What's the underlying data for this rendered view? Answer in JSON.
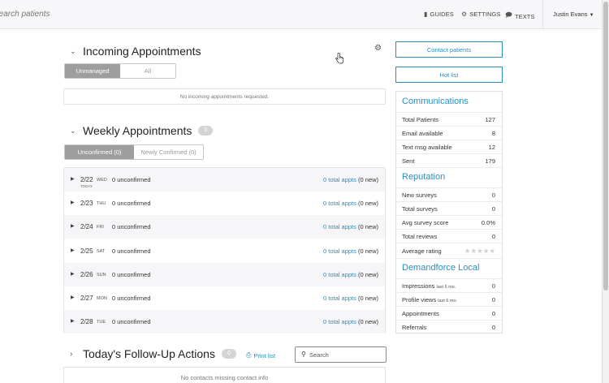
{
  "topbar": {
    "search_placeholder": "Search patients",
    "guides_label": "GUIDES",
    "settings_label": "SETTINGS",
    "texts_label": "TEXTS",
    "user_name": "Justin Evans"
  },
  "incoming": {
    "title": "Incoming Appointments",
    "tabs": [
      {
        "label": "Unmanaged",
        "active": true
      },
      {
        "label": "All",
        "active": false
      }
    ],
    "empty_message": "No incoming appointments requested."
  },
  "weekly": {
    "title": "Weekly Appointments",
    "count": "0",
    "tabs": [
      {
        "label": "Unconfirmed (0)",
        "active": true
      },
      {
        "label": "Newly Confirmed (0)",
        "active": false
      }
    ],
    "rows": [
      {
        "date": "2/22",
        "day": "WED",
        "today": "TODAY",
        "unconfirmed": "0 unconfirmed",
        "total_link": "0 total appts",
        "new": "(0 new)"
      },
      {
        "date": "2/23",
        "day": "THU",
        "today": "",
        "unconfirmed": "0 unconfirmed",
        "total_link": "0 total appts",
        "new": "(0 new)"
      },
      {
        "date": "2/24",
        "day": "FRI",
        "today": "",
        "unconfirmed": "0 unconfirmed",
        "total_link": "0 total appts",
        "new": "(0 new)"
      },
      {
        "date": "2/25",
        "day": "SAT",
        "today": "",
        "unconfirmed": "0 unconfirmed",
        "total_link": "0 total appts",
        "new": "(0 new)"
      },
      {
        "date": "2/26",
        "day": "SUN",
        "today": "",
        "unconfirmed": "0 unconfirmed",
        "total_link": "0 total appts",
        "new": "(0 new)"
      },
      {
        "date": "2/27",
        "day": "MON",
        "today": "",
        "unconfirmed": "0 unconfirmed",
        "total_link": "0 total appts",
        "new": "(0 new)"
      },
      {
        "date": "2/28",
        "day": "TUE",
        "today": "",
        "unconfirmed": "0 unconfirmed",
        "total_link": "0 total appts",
        "new": "(0 new)"
      }
    ]
  },
  "followup": {
    "title": "Today's Follow-Up Actions",
    "count": "0",
    "print_label": "Print list",
    "search_placeholder": "Search",
    "empty_message": "No contacts missing contact info"
  },
  "sidebar": {
    "contact_button": "Contact patients",
    "hotlist_button": "Hot list",
    "communications": {
      "title": "Communications",
      "rows": [
        {
          "label": "Total Patients",
          "value": "127"
        },
        {
          "label": "Email available",
          "value": "8"
        },
        {
          "label": "Text msg available",
          "value": "12"
        },
        {
          "label": "Sent",
          "value": "179"
        }
      ]
    },
    "reputation": {
      "title": "Reputation",
      "rows": [
        {
          "label": "New surveys",
          "value": "0"
        },
        {
          "label": "Total surveys",
          "value": "0"
        },
        {
          "label": "Avg survey score",
          "value": "0.0%"
        },
        {
          "label": "Total reviews",
          "value": "0"
        }
      ],
      "rating_label": "Average rating",
      "rating_stars": 0
    },
    "demandforce": {
      "title": "Demandforce Local",
      "rows": [
        {
          "label": "Impressions",
          "note": "last 6 mo.",
          "value": "0"
        },
        {
          "label": "Profile views",
          "note": "last 6 mo.",
          "value": "0"
        },
        {
          "label": "Appointments",
          "note": "",
          "value": "0"
        },
        {
          "label": "Referrals",
          "note": "",
          "value": "0"
        }
      ]
    }
  },
  "colors": {
    "accent": "#2a8fbd",
    "toggle_active": "#9e9e9e",
    "row_shade": "#f6f6f8"
  }
}
